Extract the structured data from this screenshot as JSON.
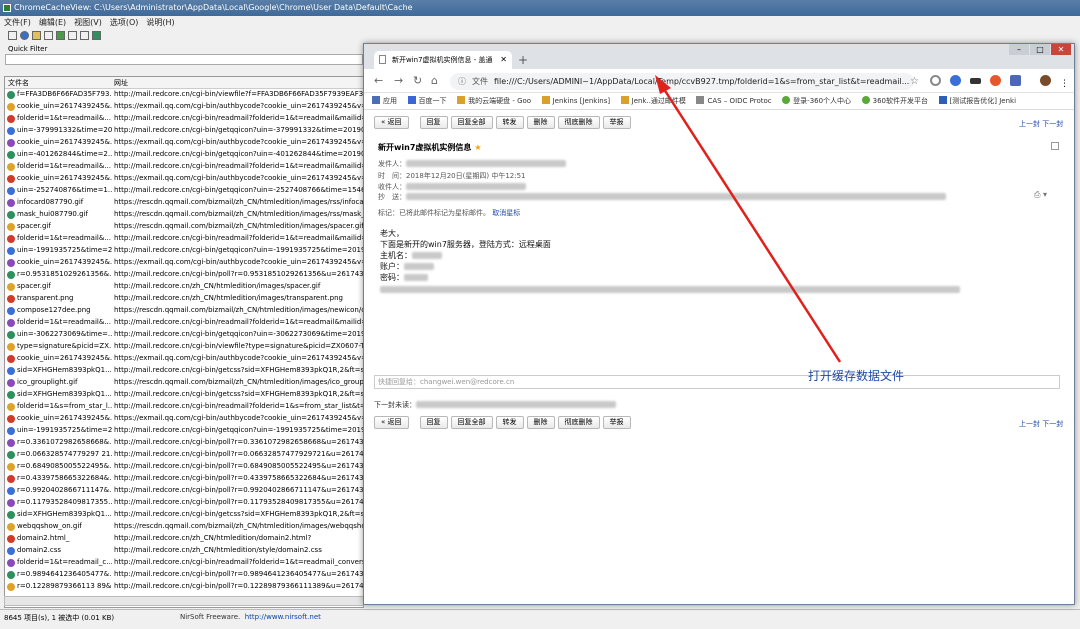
{
  "ccv": {
    "title": "ChromeCacheView:  C:\\Users\\Administrator\\AppData\\Local\\Google\\Chrome\\User Data\\Default\\Cache",
    "menu": [
      "文件(F)",
      "编辑(E)",
      "视图(V)",
      "选项(O)",
      "说明(H)"
    ],
    "quick_filter": "Quick Filter",
    "col_filename": "文件名",
    "col_url": "网址",
    "rows": [
      {
        "name": "f=FFA3DB6F66FAD35F793...",
        "url": "http://mail.redcore.cn/cgi-bin/viewfile?f=FFA3DB6F66FAD35F7939EAF37151"
      },
      {
        "name": "cookie_uin=2617439245&...",
        "url": "https://exmail.qq.com/cgi-bin/authbycode?cookie_uin=2617439245&v=0"
      },
      {
        "name": "folderid=1&t=readmail&...",
        "url": "http://mail.redcore.cn/cgi-bin/readmail?folderid=1&t=readmail&mailid=ZC"
      },
      {
        "name": "uin=-379991332&time=20...",
        "url": "http://mail.redcore.cn/cgi-bin/getqqicon?uin=-379991332&time=20190108"
      },
      {
        "name": "cookie_uin=2617439245&...",
        "url": "https://exmail.qq.com/cgi-bin/authbycode?cookie_uin=2617439245&v=0"
      },
      {
        "name": "uin=-401262844&time=2...",
        "url": "http://mail.redcore.cn/cgi-bin/getqqicon?uin=-401262844&time=20190108"
      },
      {
        "name": "folderid=1&t=readmail&...",
        "url": "http://mail.redcore.cn/cgi-bin/readmail?folderid=1&t=readmail&mailid=ZC"
      },
      {
        "name": "cookie_uin=2617439245&...",
        "url": "https://exmail.qq.com/cgi-bin/authbycode?cookie_uin=2617439245&v=0"
      },
      {
        "name": "uin=-252740876&time=1...",
        "url": "http://mail.redcore.cn/cgi-bin/getqqicon?uin=-2527408766&time=1546936"
      },
      {
        "name": "infocard087790.gif",
        "url": "https://rescdn.qqmail.com/bizmail/zh_CN/htmledition/images/rss/infocard0"
      },
      {
        "name": "mask_hui087790.gif",
        "url": "https://rescdn.qqmail.com/bizmail/zh_CN/htmledition/images/rss/mask_hui"
      },
      {
        "name": "spacer.gif",
        "url": "https://rescdn.qqmail.com/bizmail/zh_CN/htmledition/images/spacer.gif"
      },
      {
        "name": "folderid=1&t=readmail&...",
        "url": "http://mail.redcore.cn/cgi-bin/readmail?folderid=1&t=readmail&mailid=ZC"
      },
      {
        "name": "uin=-1991935725&time=2...",
        "url": "http://mail.redcore.cn/cgi-bin/getqqicon?uin=-1991935725&time=20190108"
      },
      {
        "name": "cookie_uin=2617439245&...",
        "url": "https://exmail.qq.com/cgi-bin/authbycode?cookie_uin=2617439245&v=0"
      },
      {
        "name": "r=0.9531851029261356&...",
        "url": "http://mail.redcore.cn/cgi-bin/poll?r=0.9531851029261356&u=2617439245&s=1&"
      },
      {
        "name": "spacer.gif",
        "url": "http://mail.redcore.cn/zh_CN/htmledition/images/spacer.gif"
      },
      {
        "name": "transparent.png",
        "url": "http://mail.redcore.cn/zh_CN/htmledition/images/transparent.png"
      },
      {
        "name": "compose127dee.png",
        "url": "https://rescdn.qqmail.com/bizmail/zh_CN/htmledition/images/newicon/com"
      },
      {
        "name": "folderid=1&t=readmail&...",
        "url": "http://mail.redcore.cn/cgi-bin/readmail?folderid=1&t=readmail&mailid=ZC"
      },
      {
        "name": "uin=-3062273069&time=...",
        "url": "http://mail.redcore.cn/cgi-bin/getqqicon?uin=-3062273069&time=20190108"
      },
      {
        "name": "type=signature&picid=ZX...",
        "url": "http://mail.redcore.cn/cgi-bin/viewfile?type=signature&picid=ZX0607-Tv_l9"
      },
      {
        "name": "cookie_uin=2617439245&...",
        "url": "https://exmail.qq.com/cgi-bin/authbycode?cookie_uin=2617439245&v=0"
      },
      {
        "name": "sid=XFHGHem8393pkQ1...",
        "url": "http://mail.redcore.cn/cgi-bin/getcss?sid=XFHGHem8393pkQ1R,2&ft=skin&"
      },
      {
        "name": "ico_grouplight.gif",
        "url": "https://rescdn.qqmail.com/bizmail/zh_CN/htmledition/images/ico_grouplig"
      },
      {
        "name": "sid=XFHGHem8393pkQ1...",
        "url": "http://mail.redcore.cn/cgi-bin/getcss?sid=XFHGHem8393pkQ1R,2&ft=skin&"
      },
      {
        "name": "folderid=1&s=from_star_l...",
        "url": "http://mail.redcore.cn/cgi-bin/readmail?folderid=1&s=from_star_list&t=rea"
      },
      {
        "name": "cookie_uin=2617439245&...",
        "url": "https://exmail.qq.com/cgi-bin/authbycode?cookie_uin=2617439245&v=0"
      },
      {
        "name": "uin=-1991935725&time=2...",
        "url": "http://mail.redcore.cn/cgi-bin/getqqicon?uin=-1991935725&time=20190108"
      },
      {
        "name": "r=0.3361072982658668&...",
        "url": "http://mail.redcore.cn/cgi-bin/poll?r=0.3361072982658668&u=2617439245&s=1&"
      },
      {
        "name": "r=0.066328574779297 21...",
        "url": "http://mail.redcore.cn/cgi-bin/poll?r=0.06632857477929721&u=2617439245&s=1&"
      },
      {
        "name": "r=0.6849085005522495&...",
        "url": "http://mail.redcore.cn/cgi-bin/poll?r=0.6849085005522495&u=2617439245&s=1&"
      },
      {
        "name": "r=0.4339758665322684&...",
        "url": "http://mail.redcore.cn/cgi-bin/poll?r=0.4339758665322684&u=2617439245&s=1&"
      },
      {
        "name": "r=0.9920402866711147&...",
        "url": "http://mail.redcore.cn/cgi-bin/poll?r=0.9920402866711147&u=2617439245&s=1&"
      },
      {
        "name": "r=0.11793528409817355...",
        "url": "http://mail.redcore.cn/cgi-bin/poll?r=0.11793528409817355&u=2617439245&s=1&"
      },
      {
        "name": "sid=XFHGHem8393pkQ1...",
        "url": "http://mail.redcore.cn/cgi-bin/getcss?sid=XFHGHem8393pkQ1R,2&ft=skin&"
      },
      {
        "name": "webqqshow_on.gif",
        "url": "https://rescdn.qqmail.com/bizmail/zh_CN/htmledition/images/webqqshow_"
      },
      {
        "name": "domain2.html_",
        "url": "http://mail.redcore.cn/zh_CN/htmledition/domain2.html?"
      },
      {
        "name": "domain2.css",
        "url": "http://mail.redcore.cn/zh_CN/htmledition/style/domain2.css"
      },
      {
        "name": "folderid=1&t=readmail_c...",
        "url": "http://mail.redcore.cn/cgi-bin/readmail?folderid=1&t=readmail_conversati"
      },
      {
        "name": "r=0.9894641236405477&...",
        "url": "http://mail.redcore.cn/cgi-bin/poll?r=0.9894641236405477&u=2617439245&s=1&"
      },
      {
        "name": "r=0.12289879366113 89&...",
        "url": "http://mail.redcore.cn/cgi-bin/poll?r=0.12289879366111389&u=2617439245&s=1&"
      }
    ],
    "status_count": "8645 项目(s), 1 被选中  (0.01 KB)",
    "status_brand": "NirSoft Freeware.",
    "status_url": "http://www.nirsoft.net"
  },
  "chrome": {
    "tab_title": "新开win7虚拟机实例信息 - 盖通",
    "url_label": "文件",
    "url": "file:///C:/Users/ADMINI~1/AppData/Local/Temp/ccvB927.tmp/folderid=1&s=from_star_list&t=readmail...",
    "bookmarks": [
      "应用",
      "百度一下",
      "我的云端硬盘 - Goo",
      "Jenkins [Jenkins]",
      "Jenk..通过邮件模",
      "CAS – OIDC Protoc",
      "登录-360个人中心",
      "360软件开发平台",
      "[测试报告优化] Jenki"
    ]
  },
  "mail": {
    "buttons": [
      "« 返回",
      "回复",
      "回复全部",
      "转发",
      "删除",
      "彻底删除",
      "举报"
    ],
    "prev_next": "上一封  下一封",
    "subject": "新开win7虚拟机实例信息",
    "from_label": "发件人：",
    "time_label": "时　间：",
    "time_value": "2018年12月20日(星期四) 中午12:51",
    "to_label": "收件人：",
    "cc_label": "抄　送：",
    "star_note": "标记：已将此邮件标记为星标邮件。",
    "unstar": "取消星标",
    "greeting": "老大，",
    "line1": "下面是新开的win7服务器，登陆方式：远程桌面",
    "host_label": "主机名：",
    "account_label": "账户：",
    "password_label": "密码：",
    "reply_placeholder": "快捷回复给：changwei.wen@redcore.cn",
    "next_label": "下一封未读："
  },
  "annotation": "打开缓存数据文件",
  "colors": {
    "accent": "#1f4aa8",
    "arrow": "#e0201b"
  }
}
